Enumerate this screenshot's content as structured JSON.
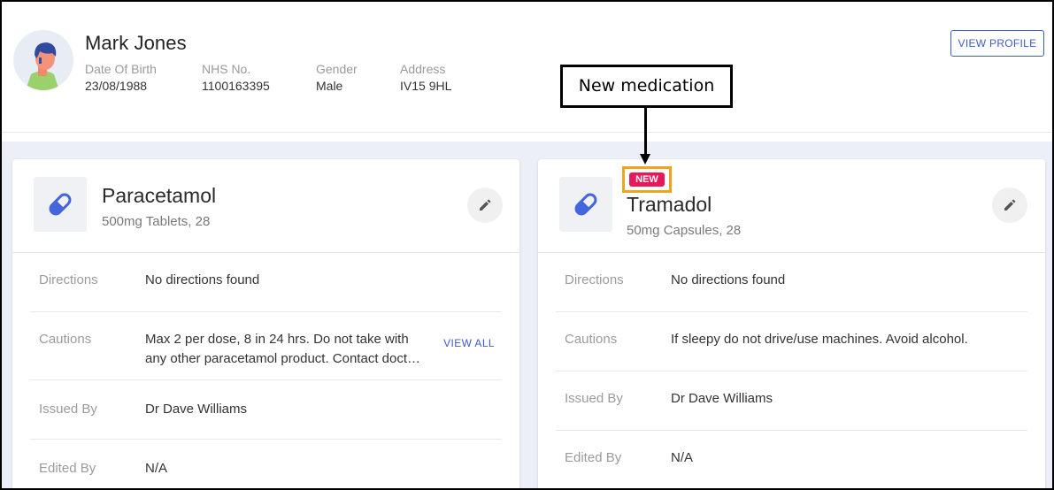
{
  "patient": {
    "name": "Mark Jones",
    "fields": [
      {
        "label": "Date Of Birth",
        "value": "23/08/1988"
      },
      {
        "label": "NHS No.",
        "value": "1100163395"
      },
      {
        "label": "Gender",
        "value": "Male"
      },
      {
        "label": "Address",
        "value": "IV15 9HL"
      }
    ],
    "view_profile_label": "VIEW PROFILE"
  },
  "annotation": {
    "callout_text": "New medication"
  },
  "cards": [
    {
      "name": "Paracetamol",
      "detail": "500mg Tablets, 28",
      "rows": [
        {
          "label": "Directions",
          "value": "No directions found"
        },
        {
          "label": "Cautions",
          "value_line1": "Max 2 per dose, 8 in 24 hrs. Do not take with",
          "value_line2": "any other paracetamol product. Contact doct…",
          "action": "VIEW ALL"
        },
        {
          "label": "Issued By",
          "value": "Dr Dave Williams"
        },
        {
          "label": "Edited By",
          "value": "N/A"
        }
      ]
    },
    {
      "badge": "NEW",
      "name": "Tramadol",
      "detail": "50mg Capsules, 28",
      "rows": [
        {
          "label": "Directions",
          "value": "No directions found"
        },
        {
          "label": "Cautions",
          "value": "If sleepy do not drive/use machines. Avoid alcohol."
        },
        {
          "label": "Issued By",
          "value": "Dr Dave Williams"
        },
        {
          "label": "Edited By",
          "value": "N/A"
        }
      ]
    }
  ],
  "colors": {
    "accent": "#3f5bc8",
    "badge": "#e8195a",
    "highlight": "#f0a31c",
    "pill": "#4466dd",
    "background": "#eceff7"
  },
  "icons": {
    "avatar": "person-avatar-icon",
    "medication": "pill-capsule-icon",
    "edit": "pencil-icon"
  }
}
